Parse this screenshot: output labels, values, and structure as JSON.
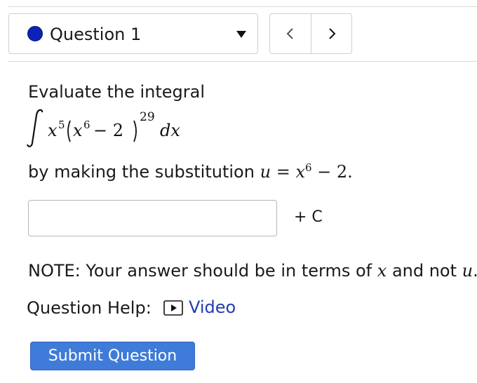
{
  "header": {
    "question_label": "Question 1",
    "prev_label": "<",
    "next_label": ">"
  },
  "problem": {
    "prompt": "Evaluate the integral",
    "integral": {
      "coefficient_base": "x",
      "coefficient_exp": "5",
      "inner_base": "x",
      "inner_exp": "6",
      "inner_minus": "− 2",
      "outer_exp": "29",
      "differential": "dx"
    },
    "substitution_prefix": "by making the substitution",
    "substitution_math": {
      "lhs": "u",
      "eq": "=",
      "base": "x",
      "exp": "6",
      "rest": "− 2."
    }
  },
  "answer": {
    "value": "",
    "placeholder": "",
    "suffix": "+ C"
  },
  "note": {
    "prefix": "NOTE: Your answer should be in terms of",
    "var1": "x",
    "middle": "and not",
    "var2": "u",
    "end": "."
  },
  "help": {
    "label": "Question Help:",
    "video_label": "Video"
  },
  "submit_label": "Submit Question",
  "colors": {
    "accent": "#3f7bd8",
    "link": "#1f3fb0",
    "question_dot": "#0a22b5"
  }
}
